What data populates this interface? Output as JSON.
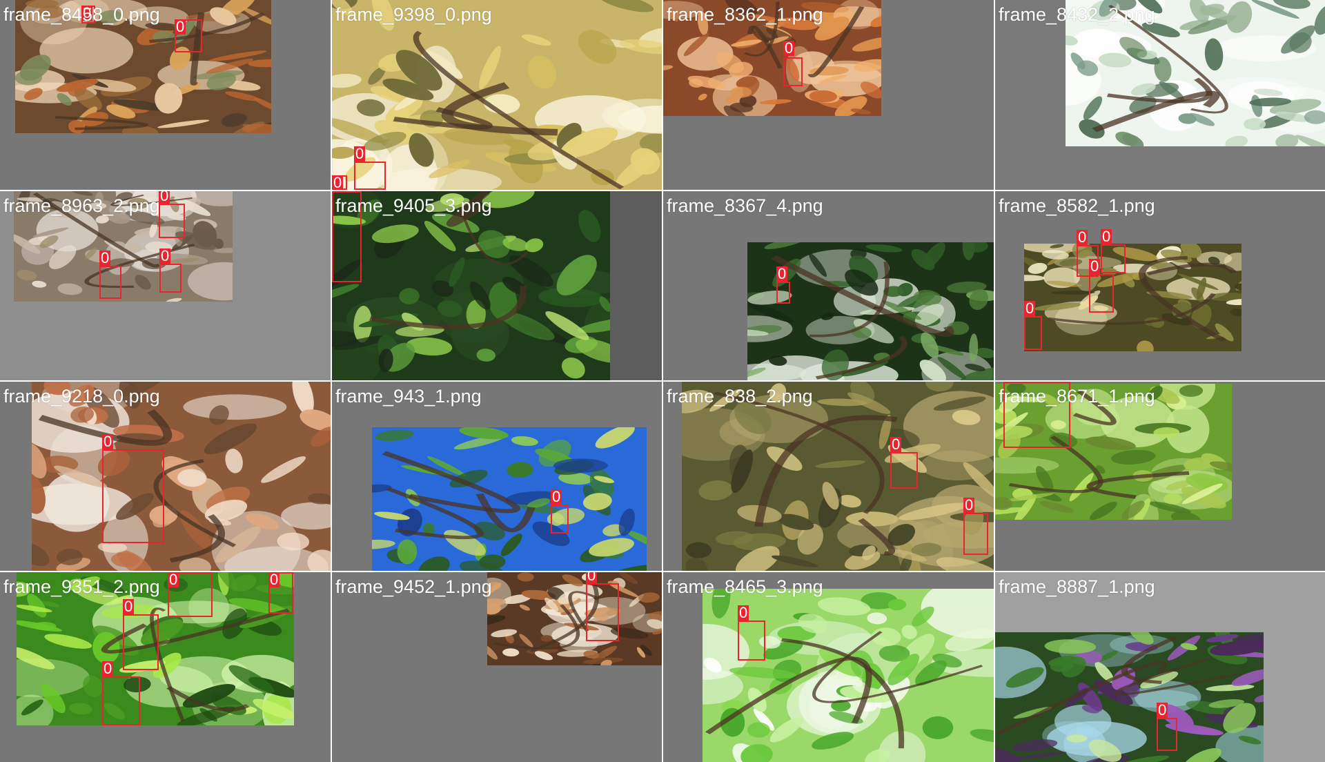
{
  "colors": {
    "box_stroke": "#e8242e",
    "label_bg": "#e8242e",
    "label_text": "#ffffff",
    "filename_text": "#ffffff"
  },
  "tiles": [
    {
      "file": "frame_8458_0.png",
      "theme": "rust",
      "bg": "#777777",
      "detections": [
        {
          "class": "0"
        },
        {
          "class": "0"
        }
      ]
    },
    {
      "file": "frame_9398_0.png",
      "theme": "yellow",
      "bg": "#777777",
      "detections": [
        {
          "class": "0"
        },
        {
          "class": "0"
        }
      ]
    },
    {
      "file": "frame_8362_1.png",
      "theme": "orange",
      "bg": "#777777",
      "detections": [
        {
          "class": "0"
        }
      ]
    },
    {
      "file": "frame_8432_2.png",
      "theme": "pale",
      "bg": "#7a7a7a",
      "detections": []
    },
    {
      "file": "frame_8963_2.png",
      "theme": "grey",
      "bg": "#8f8f8f",
      "detections": [
        {
          "class": "0"
        },
        {
          "class": "0"
        },
        {
          "class": "0"
        }
      ]
    },
    {
      "file": "frame_9405_3.png",
      "theme": "green",
      "bg": "#5d5d5d",
      "detections": [
        {
          "class": "0"
        }
      ]
    },
    {
      "file": "frame_8367_4.png",
      "theme": "darkgreen",
      "bg": "#777777",
      "detections": [
        {
          "class": "0"
        }
      ]
    },
    {
      "file": "frame_8582_1.png",
      "theme": "olive",
      "bg": "#777777",
      "detections": [
        {
          "class": "0"
        },
        {
          "class": "0"
        },
        {
          "class": "0"
        },
        {
          "class": "0"
        }
      ]
    },
    {
      "file": "frame_9218_0.png",
      "theme": "rust2",
      "bg": "#777777",
      "detections": [
        {
          "class": "0"
        }
      ]
    },
    {
      "file": "frame_943_1.png",
      "theme": "sky",
      "bg": "#777777",
      "detections": [
        {
          "class": "0"
        }
      ]
    },
    {
      "file": "frame_838_2.png",
      "theme": "olive2",
      "bg": "#777777",
      "detections": [
        {
          "class": "0"
        },
        {
          "class": "0"
        }
      ]
    },
    {
      "file": "frame_8671_1.png",
      "theme": "lime",
      "bg": "#777777",
      "detections": [
        {
          "class": "0"
        }
      ]
    },
    {
      "file": "frame_9351_2.png",
      "theme": "bright",
      "bg": "#777777",
      "detections": [
        {
          "class": "0"
        },
        {
          "class": "0"
        },
        {
          "class": "0"
        },
        {
          "class": "0"
        }
      ]
    },
    {
      "file": "frame_9452_1.png",
      "theme": "brown",
      "bg": "#777777",
      "detections": [
        {
          "class": "0"
        }
      ]
    },
    {
      "file": "frame_8465_3.png",
      "theme": "light",
      "bg": "#777777",
      "detections": [
        {
          "class": "0"
        }
      ]
    },
    {
      "file": "frame_8887_1.png",
      "theme": "purple",
      "bg": "#a0a0a0",
      "detections": [
        {
          "class": "0"
        }
      ]
    }
  ]
}
